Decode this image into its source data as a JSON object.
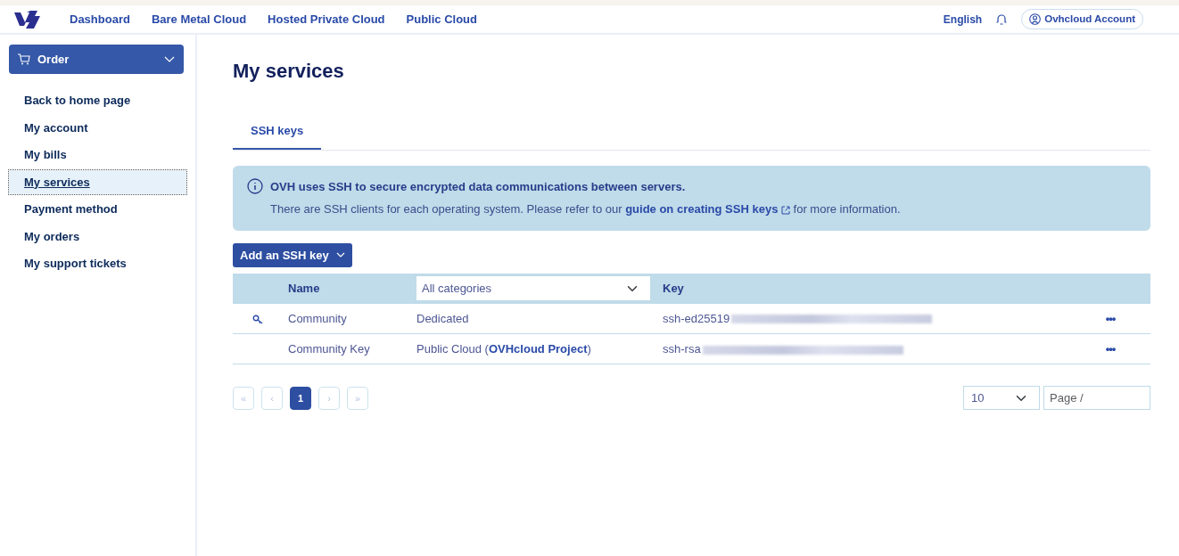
{
  "topnav": {
    "links": [
      {
        "label": "Dashboard"
      },
      {
        "label": "Bare Metal Cloud"
      },
      {
        "label": "Hosted Private Cloud"
      },
      {
        "label": "Public Cloud"
      }
    ],
    "language": "English",
    "account": "Ovhcloud Account"
  },
  "sidebar": {
    "order_button": "Order",
    "items": [
      {
        "label": "Back to home page",
        "selected": false
      },
      {
        "label": "My account",
        "selected": false
      },
      {
        "label": "My bills",
        "selected": false
      },
      {
        "label": "My services",
        "selected": true
      },
      {
        "label": "Payment method",
        "selected": false
      },
      {
        "label": "My orders",
        "selected": false
      },
      {
        "label": "My support tickets",
        "selected": false
      }
    ]
  },
  "page_title": "My services",
  "tabs": [
    {
      "label": "SSH keys",
      "selected": true
    }
  ],
  "info": {
    "title": "OVH uses SSH to secure encrypted data communications between servers.",
    "text_before": "There are SSH clients for each operating system. Please refer to our",
    "link": "guide on creating SSH keys",
    "text_after": "for more information."
  },
  "add_button": "Add an SSH key",
  "table": {
    "columns": {
      "name": "Name",
      "category_filter": "All categories",
      "key": "Key"
    },
    "rows": [
      {
        "default_key": true,
        "name": "Community",
        "category": "Dedicated",
        "key": "ssh-ed25519",
        "menu": "•••"
      },
      {
        "default_key": false,
        "name": "Community Key",
        "category": "Public Cloud (**OVHcloud Project**)",
        "key": "ssh-rsa",
        "menu": "•••"
      }
    ]
  },
  "pagination": [
    {
      "label": "«",
      "selected": false,
      "disabled": true
    },
    {
      "label": "‹",
      "selected": false,
      "disabled": true
    },
    {
      "label": "1",
      "selected": true,
      "disabled": false
    },
    {
      "label": "›",
      "selected": false,
      "disabled": true
    },
    {
      "label": "»",
      "selected": false,
      "disabled": true
    }
  ],
  "page_size": "10",
  "page_input": {
    "placeholder": "Page /"
  }
}
